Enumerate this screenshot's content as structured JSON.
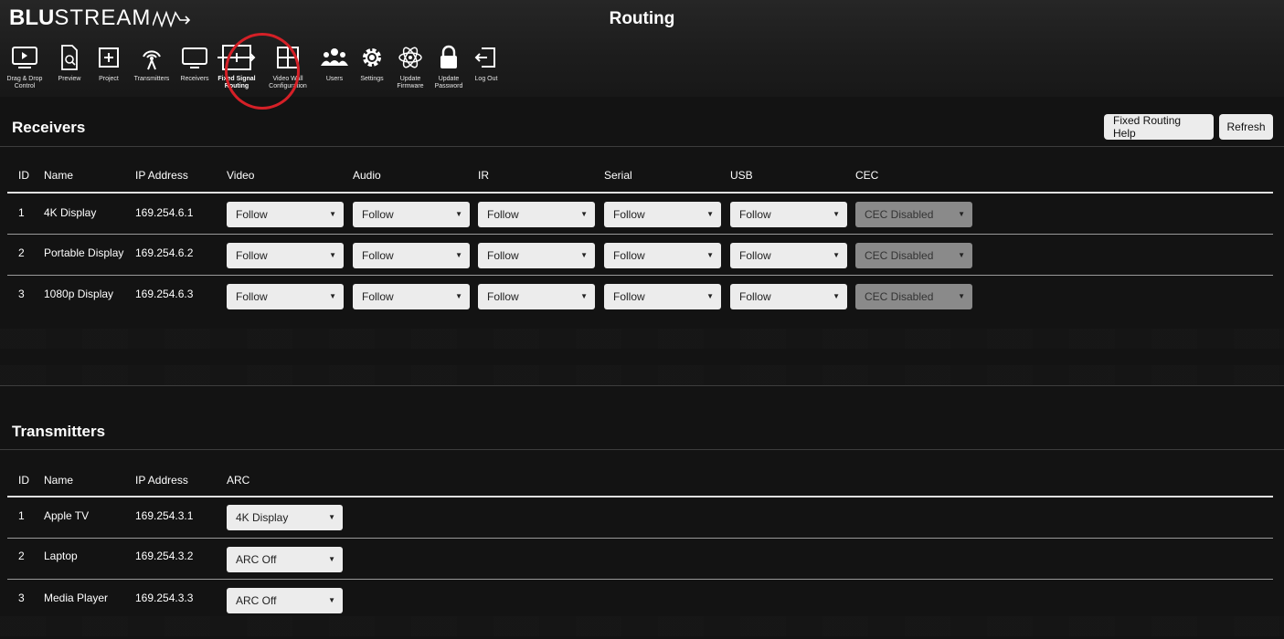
{
  "brand": {
    "logo_bold": "BLU",
    "logo_light": "STREAM"
  },
  "page_title": "Routing",
  "toolbar": [
    {
      "label": "Drag & Drop\nControl",
      "icon": "play-icon"
    },
    {
      "label": "Preview",
      "icon": "preview-icon"
    },
    {
      "label": "Project",
      "icon": "project-icon"
    },
    {
      "label": "Transmitters",
      "icon": "antenna-icon"
    },
    {
      "label": "Receivers",
      "icon": "monitor-icon"
    },
    {
      "label": "Fixed Signal\nRouting",
      "icon": "routing-icon",
      "active": true
    },
    {
      "label": "Video Wall\nConfiguration",
      "icon": "grid-icon"
    },
    {
      "label": "Users",
      "icon": "users-icon"
    },
    {
      "label": "Settings",
      "icon": "gear-icon"
    },
    {
      "label": "Update\nFirmware",
      "icon": "atom-icon"
    },
    {
      "label": "Update\nPassword",
      "icon": "lock-icon"
    },
    {
      "label": "Log Out",
      "icon": "logout-icon"
    }
  ],
  "receivers": {
    "title": "Receivers",
    "help_button": "Fixed Routing Help",
    "refresh_button": "Refresh",
    "columns": [
      "ID",
      "Name",
      "IP Address",
      "Video",
      "Audio",
      "IR",
      "Serial",
      "USB",
      "CEC"
    ],
    "rows": [
      {
        "id": "1",
        "name": "4K Display",
        "ip": "169.254.6.1",
        "video": "Follow",
        "audio": "Follow",
        "ir": "Follow",
        "serial": "Follow",
        "usb": "Follow",
        "cec": "CEC Disabled"
      },
      {
        "id": "2",
        "name": "Portable Display",
        "ip": "169.254.6.2",
        "video": "Follow",
        "audio": "Follow",
        "ir": "Follow",
        "serial": "Follow",
        "usb": "Follow",
        "cec": "CEC Disabled"
      },
      {
        "id": "3",
        "name": "1080p Display",
        "ip": "169.254.6.3",
        "video": "Follow",
        "audio": "Follow",
        "ir": "Follow",
        "serial": "Follow",
        "usb": "Follow",
        "cec": "CEC Disabled"
      }
    ]
  },
  "transmitters": {
    "title": "Transmitters",
    "columns": [
      "ID",
      "Name",
      "IP Address",
      "ARC"
    ],
    "rows": [
      {
        "id": "1",
        "name": "Apple TV",
        "ip": "169.254.3.1",
        "arc": "4K Display"
      },
      {
        "id": "2",
        "name": "Laptop",
        "ip": "169.254.3.2",
        "arc": "ARC Off"
      },
      {
        "id": "3",
        "name": "Media Player",
        "ip": "169.254.3.3",
        "arc": "ARC Off"
      }
    ]
  },
  "colors": {
    "accent_ring": "#d52027",
    "background": "#131313",
    "select_bg": "#ececec",
    "select_disabled_bg": "#8a8a8a"
  }
}
